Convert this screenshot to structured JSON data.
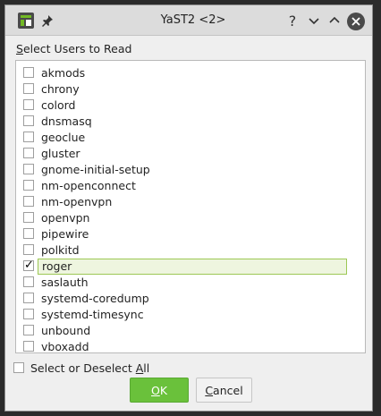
{
  "window": {
    "title": "YaST2 <2>",
    "icons": [
      "yast-app-icon",
      "pin-icon",
      "help-icon",
      "minimize-icon",
      "maximize-icon",
      "close-icon"
    ],
    "help_glyph": "?"
  },
  "section_label": {
    "first_letter": "S",
    "rest": "elect Users to Read"
  },
  "users": [
    {
      "name": "akmods",
      "checked": false
    },
    {
      "name": "chrony",
      "checked": false
    },
    {
      "name": "colord",
      "checked": false
    },
    {
      "name": "dnsmasq",
      "checked": false
    },
    {
      "name": "geoclue",
      "checked": false
    },
    {
      "name": "gluster",
      "checked": false
    },
    {
      "name": "gnome-initial-setup",
      "checked": false
    },
    {
      "name": "nm-openconnect",
      "checked": false
    },
    {
      "name": "nm-openvpn",
      "checked": false
    },
    {
      "name": "openvpn",
      "checked": false
    },
    {
      "name": "pipewire",
      "checked": false
    },
    {
      "name": "polkitd",
      "checked": false
    },
    {
      "name": "roger",
      "checked": true,
      "selected": true
    },
    {
      "name": "saslauth",
      "checked": false
    },
    {
      "name": "systemd-coredump",
      "checked": false
    },
    {
      "name": "systemd-timesync",
      "checked": false
    },
    {
      "name": "unbound",
      "checked": false
    },
    {
      "name": "vboxadd",
      "checked": false
    }
  ],
  "select_all": {
    "prefix": "Select or Deselect ",
    "mnemonic": "A",
    "suffix": "ll",
    "checked": false
  },
  "buttons": {
    "ok_mnemonic": "O",
    "ok_rest": "K",
    "cancel_mnemonic": "C",
    "cancel_rest": "ancel"
  },
  "colors": {
    "ok_button": "#6ac13b",
    "selection_border": "#9dc855",
    "selection_fill": "#eef5df"
  }
}
